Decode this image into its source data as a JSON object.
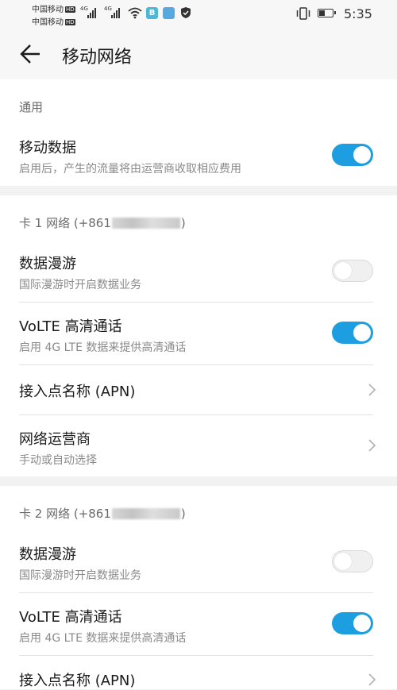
{
  "status_bar": {
    "carrier_1": "中国移动",
    "carrier_2": "中国移动",
    "hd_badge": "HD",
    "network_1": "4G",
    "network_2": "4G",
    "time": "5:35",
    "battery_level": 0.45,
    "icons": [
      "signal-icon",
      "wifi-icon",
      "app-b-icon",
      "app-icon",
      "shield-icon",
      "vibrate-icon",
      "battery-icon"
    ]
  },
  "app_bar": {
    "title": "移动网络",
    "back_icon": "arrow-left-icon"
  },
  "general": {
    "header": "通用",
    "mobile_data": {
      "title": "移动数据",
      "subtitle": "启用后，产生的流量将由运营商收取相应费用",
      "enabled": true
    }
  },
  "sim1": {
    "header_prefix": "卡 1 网络 (+861",
    "header_suffix": ")",
    "roaming": {
      "title": "数据漫游",
      "subtitle": "国际漫游时开启数据业务",
      "enabled": false
    },
    "volte": {
      "title": "VoLTE 高清通话",
      "subtitle": "启用 4G LTE 数据来提供高清通话",
      "enabled": true
    },
    "apn": {
      "title": "接入点名称 (APN)"
    },
    "carrier": {
      "title": "网络运营商",
      "subtitle": "手动或自动选择"
    }
  },
  "sim2": {
    "header_prefix": "卡 2 网络 (+861",
    "header_suffix": ")",
    "roaming": {
      "title": "数据漫游",
      "subtitle": "国际漫游时开启数据业务",
      "enabled": false
    },
    "volte": {
      "title": "VoLTE 高清通话",
      "subtitle": "启用 4G LTE 数据来提供高清通话",
      "enabled": true
    },
    "apn": {
      "title": "接入点名称 (APN)"
    }
  },
  "colors": {
    "accent": "#1d9ee0",
    "background": "#f2f2f2",
    "card": "#ffffff"
  }
}
